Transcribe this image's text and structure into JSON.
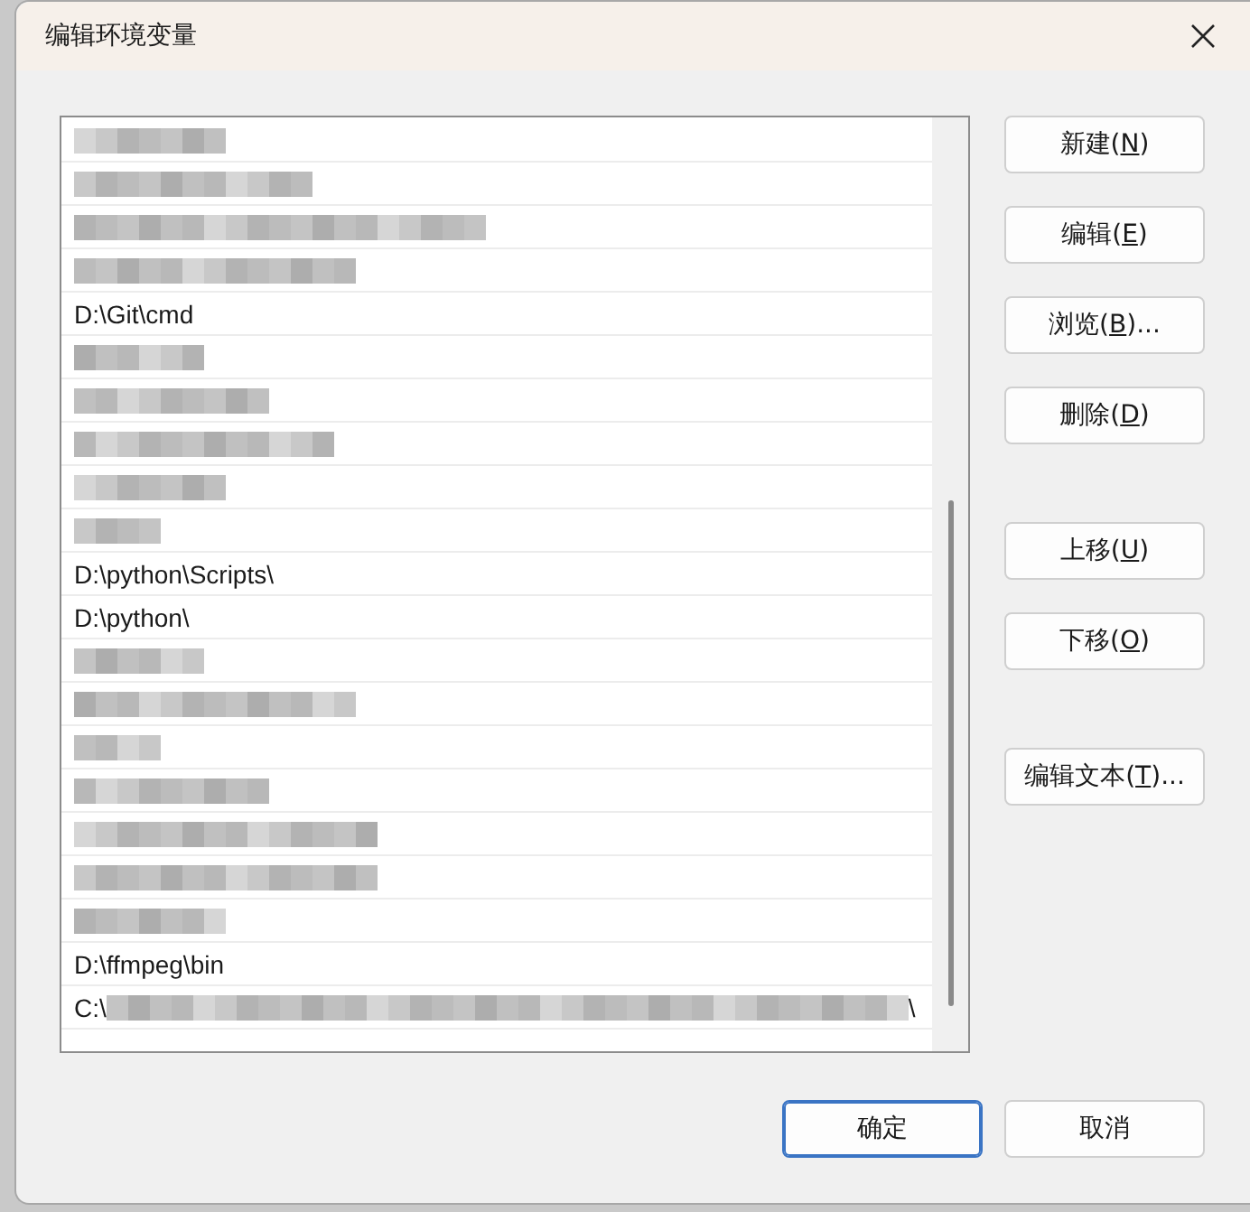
{
  "window": {
    "title": "编辑环境变量"
  },
  "entries": [
    {
      "kind": "redacted"
    },
    {
      "kind": "redacted"
    },
    {
      "kind": "redacted"
    },
    {
      "kind": "redacted"
    },
    {
      "kind": "path",
      "text": "D:\\Git\\cmd"
    },
    {
      "kind": "redacted"
    },
    {
      "kind": "redacted"
    },
    {
      "kind": "redacted"
    },
    {
      "kind": "redacted"
    },
    {
      "kind": "redacted"
    },
    {
      "kind": "path",
      "text": "D:\\python\\Scripts\\"
    },
    {
      "kind": "path",
      "text": "D:\\python\\"
    },
    {
      "kind": "redacted"
    },
    {
      "kind": "redacted"
    },
    {
      "kind": "redacted"
    },
    {
      "kind": "redacted"
    },
    {
      "kind": "redacted"
    },
    {
      "kind": "redacted"
    },
    {
      "kind": "redacted"
    },
    {
      "kind": "path",
      "text": "D:\\ffmpeg\\bin"
    },
    {
      "kind": "partial",
      "text": "C:\\",
      "end": "\\"
    }
  ],
  "side_button_groups": [
    [
      {
        "before": "新建(",
        "key": "N",
        "after": ")"
      },
      {
        "before": "编辑(",
        "key": "E",
        "after": ")"
      },
      {
        "before": "浏览(",
        "key": "B",
        "after": ")..."
      },
      {
        "before": "删除(",
        "key": "D",
        "after": ")"
      }
    ],
    [
      {
        "before": "上移(",
        "key": "U",
        "after": ")"
      },
      {
        "before": "下移(",
        "key": "O",
        "after": ")"
      }
    ],
    [
      {
        "before": "编辑文本(",
        "key": "T",
        "after": ")..."
      }
    ]
  ],
  "footer_buttons": [
    {
      "label": "确定",
      "default": true
    },
    {
      "label": "取消",
      "default": false
    }
  ]
}
